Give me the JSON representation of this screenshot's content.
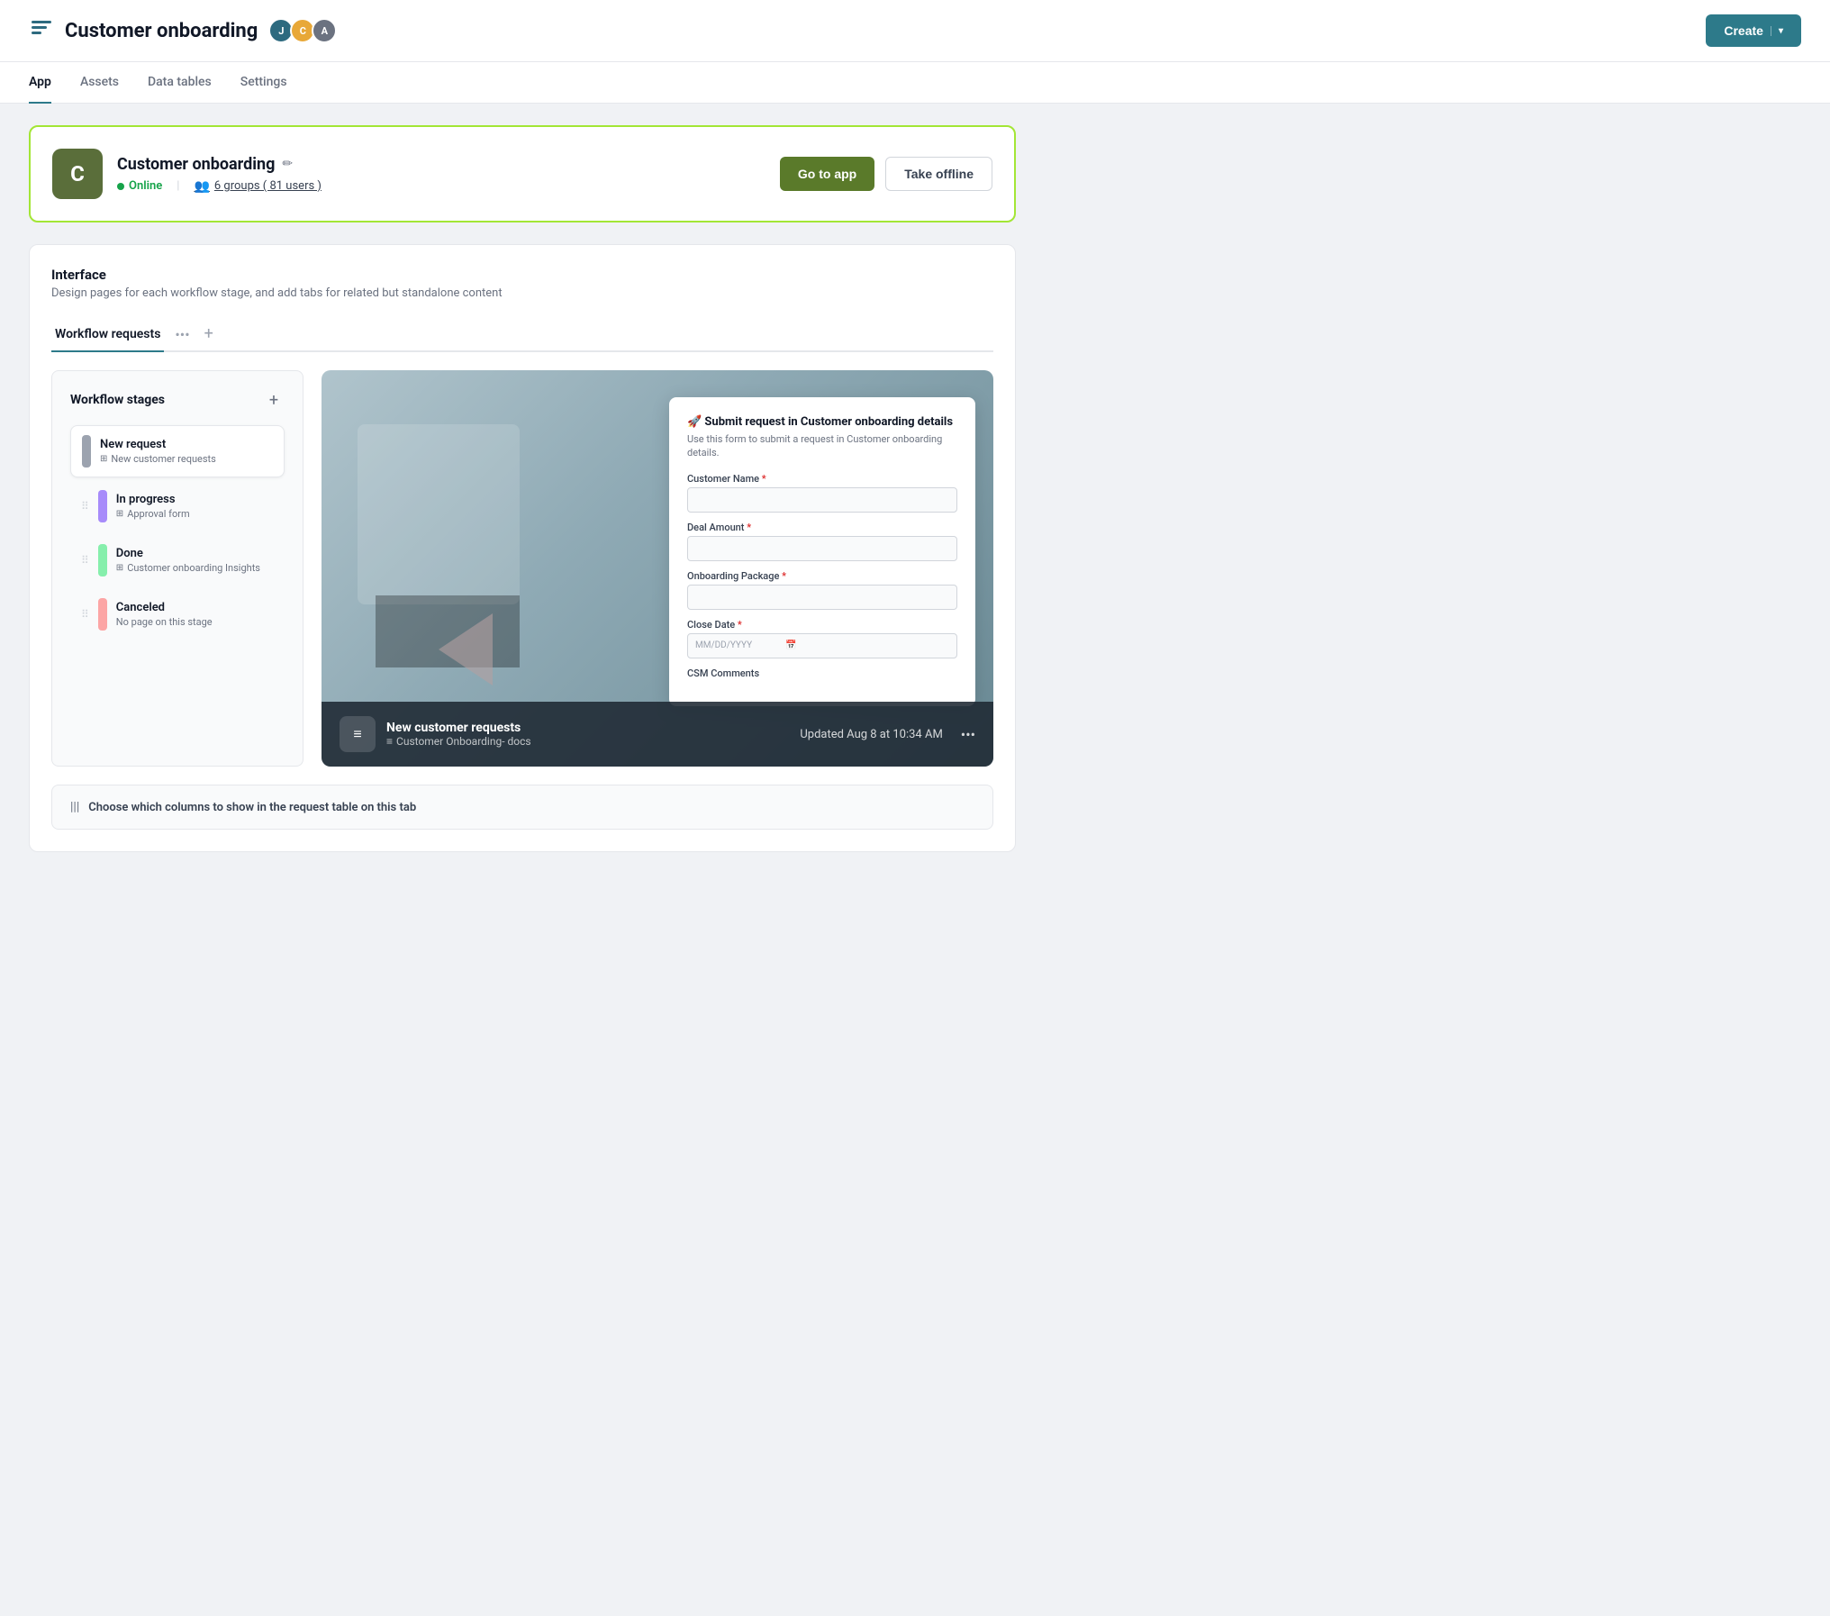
{
  "header": {
    "title": "Customer onboarding",
    "logo_alt": "app logo",
    "avatars": [
      {
        "initials": "J",
        "color": "#2d6a7f",
        "name": "J avatar"
      },
      {
        "initials": "C",
        "color": "#e8a838",
        "name": "C avatar"
      },
      {
        "initials": "A",
        "color": "#6b7280",
        "name": "A avatar"
      }
    ],
    "create_label": "Create",
    "create_chevron": "▾"
  },
  "nav": {
    "tabs": [
      {
        "label": "App",
        "active": true
      },
      {
        "label": "Assets",
        "active": false
      },
      {
        "label": "Data tables",
        "active": false
      },
      {
        "label": "Settings",
        "active": false
      }
    ]
  },
  "app_card": {
    "icon_letter": "C",
    "app_name": "Customer onboarding",
    "edit_icon": "✏",
    "status": "Online",
    "groups_text": "6 groups ( 81 users )",
    "go_to_app": "Go to app",
    "take_offline": "Take offline"
  },
  "interface": {
    "title": "Interface",
    "description": "Design pages for each workflow stage, and add tabs for related but standalone content",
    "tab_label": "Workflow requests",
    "tab_menu_icon": "•••",
    "tab_add_icon": "+"
  },
  "stages": {
    "title": "Workflow stages",
    "add_icon": "+",
    "items": [
      {
        "name": "New request",
        "sub": "New customer requests",
        "color": "new",
        "active": true,
        "show_drag": false
      },
      {
        "name": "In progress",
        "sub": "Approval form",
        "color": "in-progress",
        "active": false,
        "show_drag": true
      },
      {
        "name": "Done",
        "sub": "Customer onboarding Insights",
        "color": "done",
        "active": false,
        "show_drag": true
      },
      {
        "name": "Canceled",
        "sub": "No page on this stage",
        "color": "canceled",
        "active": false,
        "show_drag": true
      }
    ]
  },
  "form_preview": {
    "emoji": "🚀",
    "title": "Submit request in Customer onboarding details",
    "description": "Use this form to submit a request in Customer onboarding details.",
    "fields": [
      {
        "label": "Customer Name",
        "required": true
      },
      {
        "label": "Deal Amount",
        "required": true
      },
      {
        "label": "Onboarding Package",
        "required": true
      },
      {
        "label": "Close Date",
        "required": true,
        "placeholder": "MM/DD/YYYY"
      },
      {
        "label": "CSM Comments",
        "required": false
      }
    ]
  },
  "preview_bottom": {
    "doc_icon": "≡",
    "title": "New customer requests",
    "subtitle": "Customer Onboarding- docs",
    "subtitle_icon": "≡",
    "timestamp": "Updated Aug 8 at 10:34 AM",
    "more_icon": "•••"
  },
  "choose_columns": {
    "icon": "|||",
    "text": "Choose which columns to show in the request table on this tab"
  }
}
